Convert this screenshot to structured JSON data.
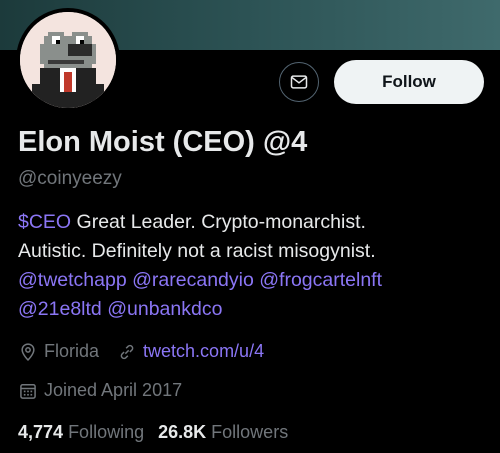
{
  "profile": {
    "name": "Elon Moist (CEO) @4",
    "handle": "@coinyeezy",
    "follow_label": "Follow"
  },
  "bio": {
    "line1_cashtag": "$CEO",
    "line1_text": " Great Leader. Crypto-monarchist.",
    "line2_text": "Autistic. Definitely not a racist misogynist.",
    "mentions_line3": [
      "@twetchapp",
      "@rarecandyio",
      "@frogcartelnft"
    ],
    "mentions_line4": [
      "@21e8ltd",
      "@unbankdco"
    ]
  },
  "meta": {
    "location": "Florida",
    "website": "twetch.com/u/4",
    "joined": "Joined April 2017"
  },
  "stats": {
    "following_count": "4,774",
    "following_label": "Following",
    "followers_count": "26.8K",
    "followers_label": "Followers"
  },
  "icons": {
    "message": "mail-icon",
    "location": "location-pin-icon",
    "website": "link-icon",
    "joined": "calendar-icon"
  },
  "colors": {
    "background": "#000000",
    "link": "#8b76f5",
    "secondary_text": "#71767b",
    "primary_text": "#e7e9ea",
    "follow_button_bg": "#eff3f4"
  }
}
